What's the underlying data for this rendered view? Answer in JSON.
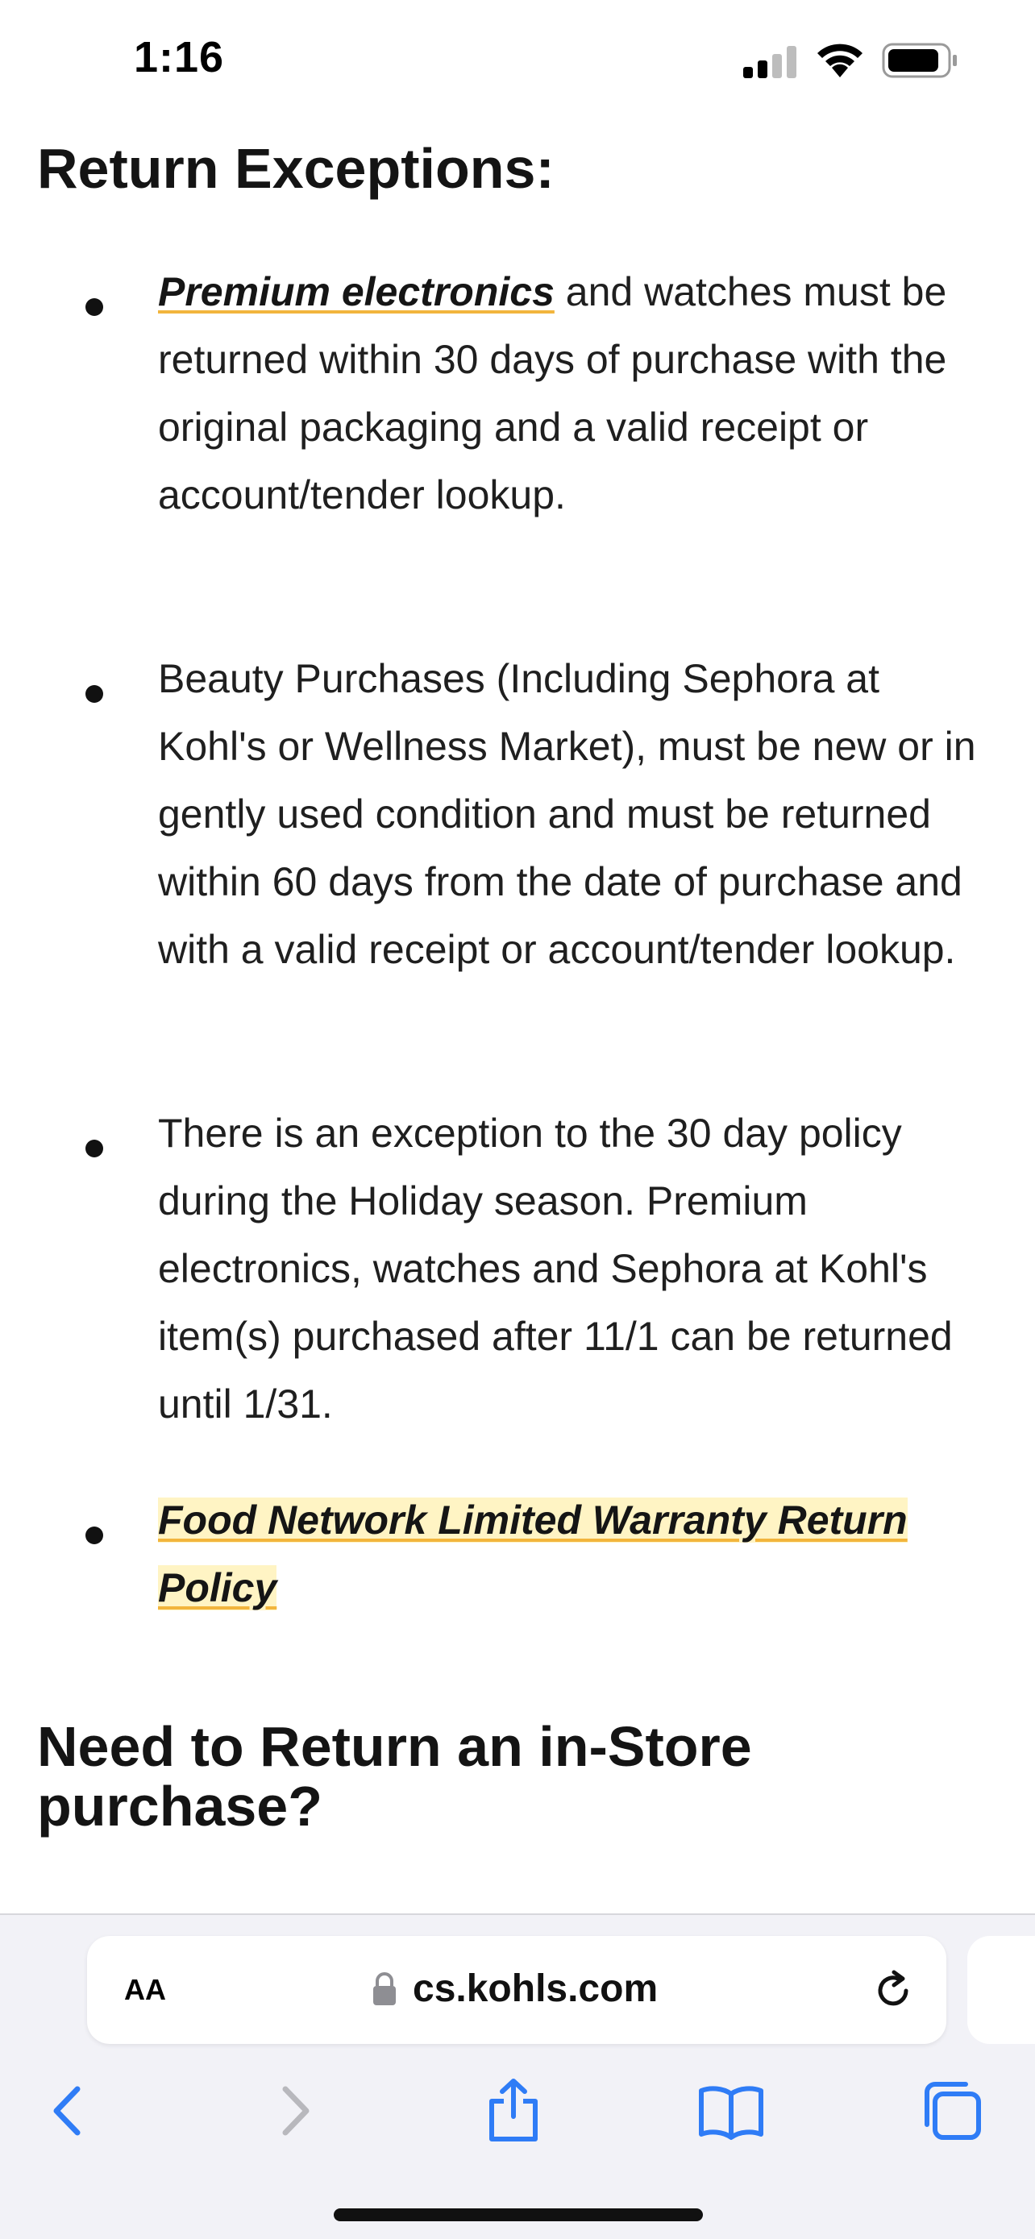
{
  "status_bar": {
    "time": "1:16"
  },
  "headings": {
    "return_exceptions": "Return Exceptions:",
    "in_store": "Need to Return an in-Store purchase?"
  },
  "bullets": [
    {
      "link": "Premium electronics",
      "text": " and watches must be returned within 30 days of purchase with the original packaging and a valid receipt or account/tender lookup."
    },
    {
      "text": "Beauty Purchases (Including Sephora at Kohl's or Wellness Market), must be new or in gently used condition and must be returned within 60 days from the date of purchase and with a valid receipt or account/tender lookup."
    },
    {
      "text": "There is an exception to the 30 day policy during the Holiday season. Premium electronics, watches and Sephora at Kohl's item(s) purchased after 11/1 can be returned until 1/31."
    },
    {
      "link": "Food Network Limited Warranty Return Policy"
    }
  ],
  "browser": {
    "aa_label": "AA",
    "url": "cs.kohls.com"
  },
  "colors": {
    "link_underline": "#f2b53d",
    "link_highlight": "#fff4c4",
    "toolbar_icon": "#2f7cf6",
    "toolbar_disabled": "#b8b8bd"
  },
  "icons": [
    "signal-icon",
    "wifi-icon",
    "battery-icon",
    "lock-icon",
    "reload-icon",
    "back-icon",
    "forward-icon",
    "share-icon",
    "bookmarks-icon",
    "tabs-icon"
  ]
}
